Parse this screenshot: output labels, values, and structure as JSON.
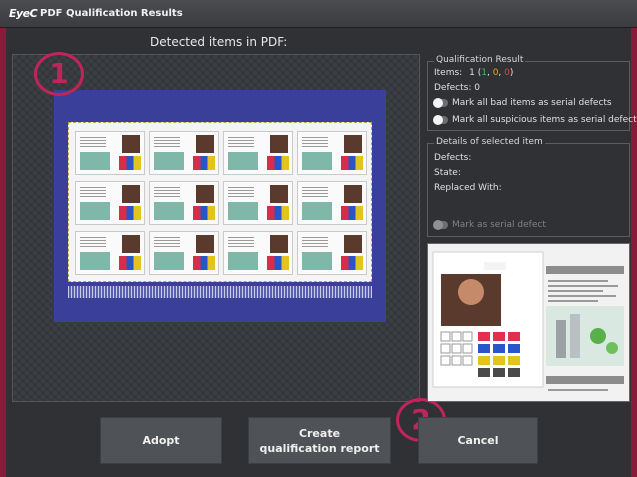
{
  "window": {
    "logo": "EyeC",
    "title": "PDF Qualification Results"
  },
  "preview": {
    "label": "Detected items in PDF:"
  },
  "badges": [
    "1",
    "2"
  ],
  "qualification": {
    "title": "Qualification Result",
    "items_label": "Items:",
    "items_total": "1",
    "items_green": "1",
    "items_orange": "0",
    "items_red": "0",
    "defects": "Defects: 0",
    "toggle_bad": "Mark all bad items as serial defects",
    "toggle_suspicious": "Mark all suspicious items as serial defects"
  },
  "details": {
    "title": "Details of selected item",
    "defects": "Defects:",
    "state": "State:",
    "replaced": "Replaced With:",
    "mark_serial": "Mark as serial defect"
  },
  "buttons": {
    "adopt": "Adopt",
    "report_line1": "Create",
    "report_line2": "qualification report",
    "cancel": "Cancel"
  },
  "colors": {
    "accent": "#c0255a",
    "green": "#3cc34a",
    "orange": "#f0a020",
    "red": "#e04040"
  }
}
